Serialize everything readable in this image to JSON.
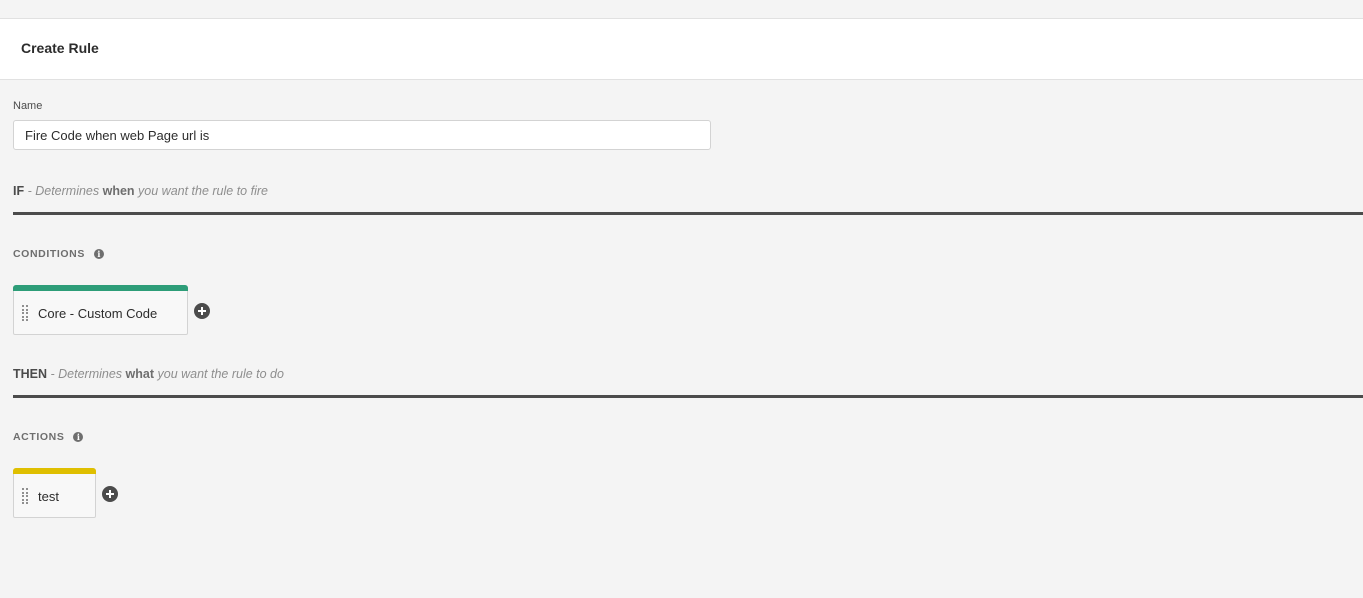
{
  "header": {
    "title": "Create Rule"
  },
  "name_field": {
    "label": "Name",
    "value": "Fire Code when web Page url is"
  },
  "if_section": {
    "keyword": "IF",
    "desc_before": " - Determines ",
    "desc_emphasis": "when",
    "desc_after": " you want the rule to fire"
  },
  "conditions": {
    "heading": "CONDITIONS",
    "info_icon": "info-icon",
    "items": [
      {
        "label": "Core - Custom Code",
        "accent_color": "#2d9d78"
      }
    ],
    "add_icon": "plus-circle-icon"
  },
  "then_section": {
    "keyword": "THEN",
    "desc_before": " - Determines ",
    "desc_emphasis": "what",
    "desc_after": " you want the rule to do"
  },
  "actions": {
    "heading": "ACTIONS",
    "info_icon": "info-icon",
    "items": [
      {
        "label": "test",
        "accent_color": "#dfbf00"
      }
    ],
    "add_icon": "plus-circle-icon"
  },
  "colors": {
    "background": "#f4f4f4",
    "header_bg": "#ffffff",
    "divider": "#4b4b4b",
    "condition_accent": "#2d9d78",
    "action_accent": "#dfbf00"
  }
}
